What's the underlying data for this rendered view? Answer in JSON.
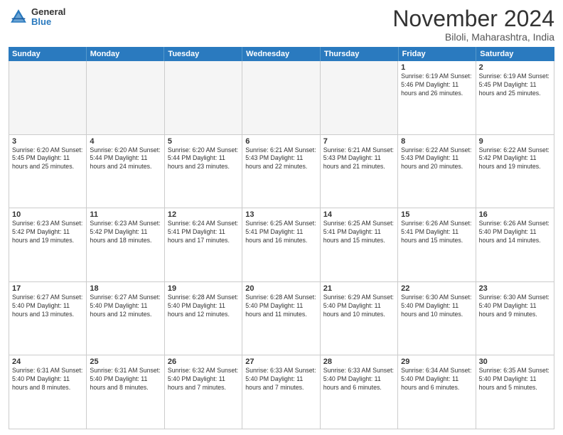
{
  "logo": {
    "general": "General",
    "blue": "Blue"
  },
  "header": {
    "title": "November 2024",
    "subtitle": "Biloli, Maharashtra, India"
  },
  "weekdays": [
    "Sunday",
    "Monday",
    "Tuesday",
    "Wednesday",
    "Thursday",
    "Friday",
    "Saturday"
  ],
  "weeks": [
    [
      {
        "day": "",
        "info": "",
        "empty": true
      },
      {
        "day": "",
        "info": "",
        "empty": true
      },
      {
        "day": "",
        "info": "",
        "empty": true
      },
      {
        "day": "",
        "info": "",
        "empty": true
      },
      {
        "day": "",
        "info": "",
        "empty": true
      },
      {
        "day": "1",
        "info": "Sunrise: 6:19 AM\nSunset: 5:46 PM\nDaylight: 11 hours\nand 26 minutes.",
        "empty": false
      },
      {
        "day": "2",
        "info": "Sunrise: 6:19 AM\nSunset: 5:45 PM\nDaylight: 11 hours\nand 25 minutes.",
        "empty": false
      }
    ],
    [
      {
        "day": "3",
        "info": "Sunrise: 6:20 AM\nSunset: 5:45 PM\nDaylight: 11 hours\nand 25 minutes.",
        "empty": false
      },
      {
        "day": "4",
        "info": "Sunrise: 6:20 AM\nSunset: 5:44 PM\nDaylight: 11 hours\nand 24 minutes.",
        "empty": false
      },
      {
        "day": "5",
        "info": "Sunrise: 6:20 AM\nSunset: 5:44 PM\nDaylight: 11 hours\nand 23 minutes.",
        "empty": false
      },
      {
        "day": "6",
        "info": "Sunrise: 6:21 AM\nSunset: 5:43 PM\nDaylight: 11 hours\nand 22 minutes.",
        "empty": false
      },
      {
        "day": "7",
        "info": "Sunrise: 6:21 AM\nSunset: 5:43 PM\nDaylight: 11 hours\nand 21 minutes.",
        "empty": false
      },
      {
        "day": "8",
        "info": "Sunrise: 6:22 AM\nSunset: 5:43 PM\nDaylight: 11 hours\nand 20 minutes.",
        "empty": false
      },
      {
        "day": "9",
        "info": "Sunrise: 6:22 AM\nSunset: 5:42 PM\nDaylight: 11 hours\nand 19 minutes.",
        "empty": false
      }
    ],
    [
      {
        "day": "10",
        "info": "Sunrise: 6:23 AM\nSunset: 5:42 PM\nDaylight: 11 hours\nand 19 minutes.",
        "empty": false
      },
      {
        "day": "11",
        "info": "Sunrise: 6:23 AM\nSunset: 5:42 PM\nDaylight: 11 hours\nand 18 minutes.",
        "empty": false
      },
      {
        "day": "12",
        "info": "Sunrise: 6:24 AM\nSunset: 5:41 PM\nDaylight: 11 hours\nand 17 minutes.",
        "empty": false
      },
      {
        "day": "13",
        "info": "Sunrise: 6:25 AM\nSunset: 5:41 PM\nDaylight: 11 hours\nand 16 minutes.",
        "empty": false
      },
      {
        "day": "14",
        "info": "Sunrise: 6:25 AM\nSunset: 5:41 PM\nDaylight: 11 hours\nand 15 minutes.",
        "empty": false
      },
      {
        "day": "15",
        "info": "Sunrise: 6:26 AM\nSunset: 5:41 PM\nDaylight: 11 hours\nand 15 minutes.",
        "empty": false
      },
      {
        "day": "16",
        "info": "Sunrise: 6:26 AM\nSunset: 5:40 PM\nDaylight: 11 hours\nand 14 minutes.",
        "empty": false
      }
    ],
    [
      {
        "day": "17",
        "info": "Sunrise: 6:27 AM\nSunset: 5:40 PM\nDaylight: 11 hours\nand 13 minutes.",
        "empty": false
      },
      {
        "day": "18",
        "info": "Sunrise: 6:27 AM\nSunset: 5:40 PM\nDaylight: 11 hours\nand 12 minutes.",
        "empty": false
      },
      {
        "day": "19",
        "info": "Sunrise: 6:28 AM\nSunset: 5:40 PM\nDaylight: 11 hours\nand 12 minutes.",
        "empty": false
      },
      {
        "day": "20",
        "info": "Sunrise: 6:28 AM\nSunset: 5:40 PM\nDaylight: 11 hours\nand 11 minutes.",
        "empty": false
      },
      {
        "day": "21",
        "info": "Sunrise: 6:29 AM\nSunset: 5:40 PM\nDaylight: 11 hours\nand 10 minutes.",
        "empty": false
      },
      {
        "day": "22",
        "info": "Sunrise: 6:30 AM\nSunset: 5:40 PM\nDaylight: 11 hours\nand 10 minutes.",
        "empty": false
      },
      {
        "day": "23",
        "info": "Sunrise: 6:30 AM\nSunset: 5:40 PM\nDaylight: 11 hours\nand 9 minutes.",
        "empty": false
      }
    ],
    [
      {
        "day": "24",
        "info": "Sunrise: 6:31 AM\nSunset: 5:40 PM\nDaylight: 11 hours\nand 8 minutes.",
        "empty": false
      },
      {
        "day": "25",
        "info": "Sunrise: 6:31 AM\nSunset: 5:40 PM\nDaylight: 11 hours\nand 8 minutes.",
        "empty": false
      },
      {
        "day": "26",
        "info": "Sunrise: 6:32 AM\nSunset: 5:40 PM\nDaylight: 11 hours\nand 7 minutes.",
        "empty": false
      },
      {
        "day": "27",
        "info": "Sunrise: 6:33 AM\nSunset: 5:40 PM\nDaylight: 11 hours\nand 7 minutes.",
        "empty": false
      },
      {
        "day": "28",
        "info": "Sunrise: 6:33 AM\nSunset: 5:40 PM\nDaylight: 11 hours\nand 6 minutes.",
        "empty": false
      },
      {
        "day": "29",
        "info": "Sunrise: 6:34 AM\nSunset: 5:40 PM\nDaylight: 11 hours\nand 6 minutes.",
        "empty": false
      },
      {
        "day": "30",
        "info": "Sunrise: 6:35 AM\nSunset: 5:40 PM\nDaylight: 11 hours\nand 5 minutes.",
        "empty": false
      }
    ]
  ]
}
